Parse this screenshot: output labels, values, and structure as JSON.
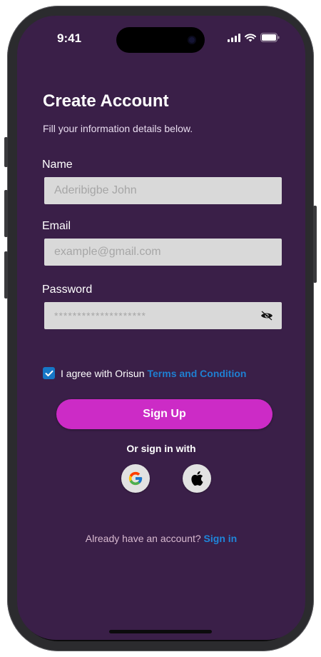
{
  "status_bar": {
    "time": "9:41"
  },
  "header": {
    "title": "Create Account",
    "subtitle": "Fill your information details below."
  },
  "form": {
    "name_label": "Name",
    "name_placeholder": "Aderibigbe John",
    "email_label": "Email",
    "email_placeholder": "example@gmail.com",
    "password_label": "Password",
    "password_value": "********************"
  },
  "agreement": {
    "checked": true,
    "text": "I agree with Orisun",
    "link": "Terms and Condition"
  },
  "actions": {
    "signup_label": "Sign Up",
    "or_text": "Or sign in with"
  },
  "social": [
    {
      "name": "google-icon"
    },
    {
      "name": "apple-icon"
    }
  ],
  "footer": {
    "question": "Already have an account?",
    "signin_link": "Sign in"
  },
  "colors": {
    "background": "#3a1f48",
    "accent": "#cc2bc6",
    "link": "#1f7fd1",
    "field_bg": "#d9d9d9"
  }
}
